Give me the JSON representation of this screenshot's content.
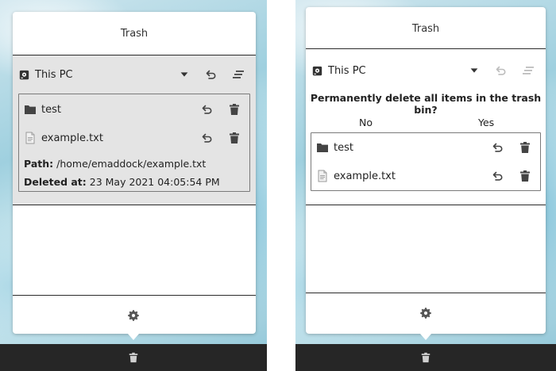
{
  "left_panel": {
    "title": "Trash",
    "device": {
      "label": "This PC",
      "icon": "drive-icon"
    },
    "items": [
      {
        "name": "test",
        "type": "folder"
      },
      {
        "name": "example.txt",
        "type": "file"
      }
    ],
    "details": {
      "path_label": "Path:",
      "path_value": " /home/emaddock/example.txt",
      "deleted_label": "Deleted at:",
      "deleted_value": " 23 May 2021 04:05:54 PM"
    }
  },
  "right_panel": {
    "title": "Trash",
    "device": {
      "label": "This PC",
      "icon": "drive-icon"
    },
    "confirm": {
      "question": "Permanently delete all items in the trash bin?",
      "no_label": "No",
      "yes_label": "Yes"
    },
    "items": [
      {
        "name": "test",
        "type": "folder"
      },
      {
        "name": "example.txt",
        "type": "file"
      }
    ]
  },
  "colors": {
    "popup_bg": "#ffffff",
    "selected_bg": "#e4e4e4",
    "taskbar_bg": "#262626",
    "icon_color": "#444444",
    "disabled_icon": "#bdbdbd"
  }
}
